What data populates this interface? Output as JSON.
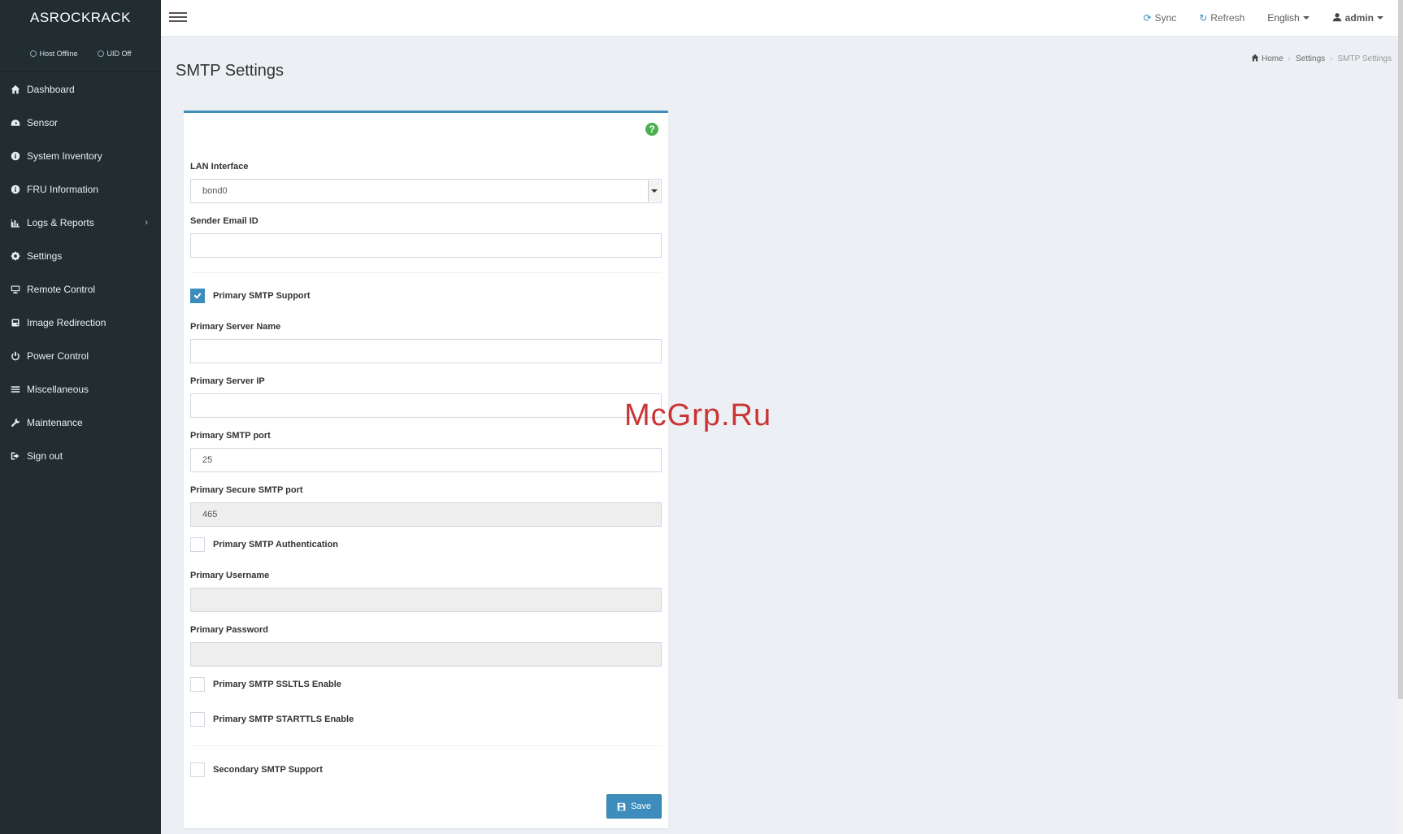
{
  "sidebar": {
    "brand": "ASROCKRACK",
    "host_status": "Host Offline",
    "uid_status": "UID Off",
    "items": [
      {
        "label": "Dashboard"
      },
      {
        "label": "Sensor"
      },
      {
        "label": "System Inventory"
      },
      {
        "label": "FRU Information"
      },
      {
        "label": "Logs & Reports"
      },
      {
        "label": "Settings"
      },
      {
        "label": "Remote Control"
      },
      {
        "label": "Image Redirection"
      },
      {
        "label": "Power Control"
      },
      {
        "label": "Miscellaneous"
      },
      {
        "label": "Maintenance"
      },
      {
        "label": "Sign out"
      }
    ]
  },
  "topbar": {
    "sync": "Sync",
    "refresh": "Refresh",
    "language": "English",
    "user": "admin"
  },
  "header": {
    "title": "SMTP Settings",
    "breadcrumb": [
      "Home",
      "Settings",
      "SMTP Settings"
    ]
  },
  "form": {
    "lan_interface": {
      "label": "LAN Interface",
      "value": "bond0"
    },
    "sender_email": {
      "label": "Sender Email ID",
      "value": ""
    },
    "primary_smtp_support": {
      "label": "Primary SMTP Support",
      "checked": true
    },
    "primary_server_name": {
      "label": "Primary Server Name",
      "value": ""
    },
    "primary_server_ip": {
      "label": "Primary Server IP",
      "value": ""
    },
    "primary_smtp_port": {
      "label": "Primary SMTP port",
      "value": "25"
    },
    "primary_secure_smtp_port": {
      "label": "Primary Secure SMTP port",
      "value": "465"
    },
    "primary_smtp_auth": {
      "label": "Primary SMTP Authentication",
      "checked": false
    },
    "primary_username": {
      "label": "Primary Username",
      "value": ""
    },
    "primary_password": {
      "label": "Primary Password",
      "value": ""
    },
    "primary_ssltls": {
      "label": "Primary SMTP SSLTLS Enable",
      "checked": false
    },
    "primary_starttls": {
      "label": "Primary SMTP STARTTLS Enable",
      "checked": false
    },
    "secondary_smtp_support": {
      "label": "Secondary SMTP Support",
      "checked": false
    },
    "save_label": "Save"
  },
  "watermark": "McGrp.Ru",
  "colors": {
    "sidebar_bg": "#222d32",
    "accent": "#3c8dbc",
    "help": "#4caf50",
    "watermark": "#c92a2a"
  }
}
